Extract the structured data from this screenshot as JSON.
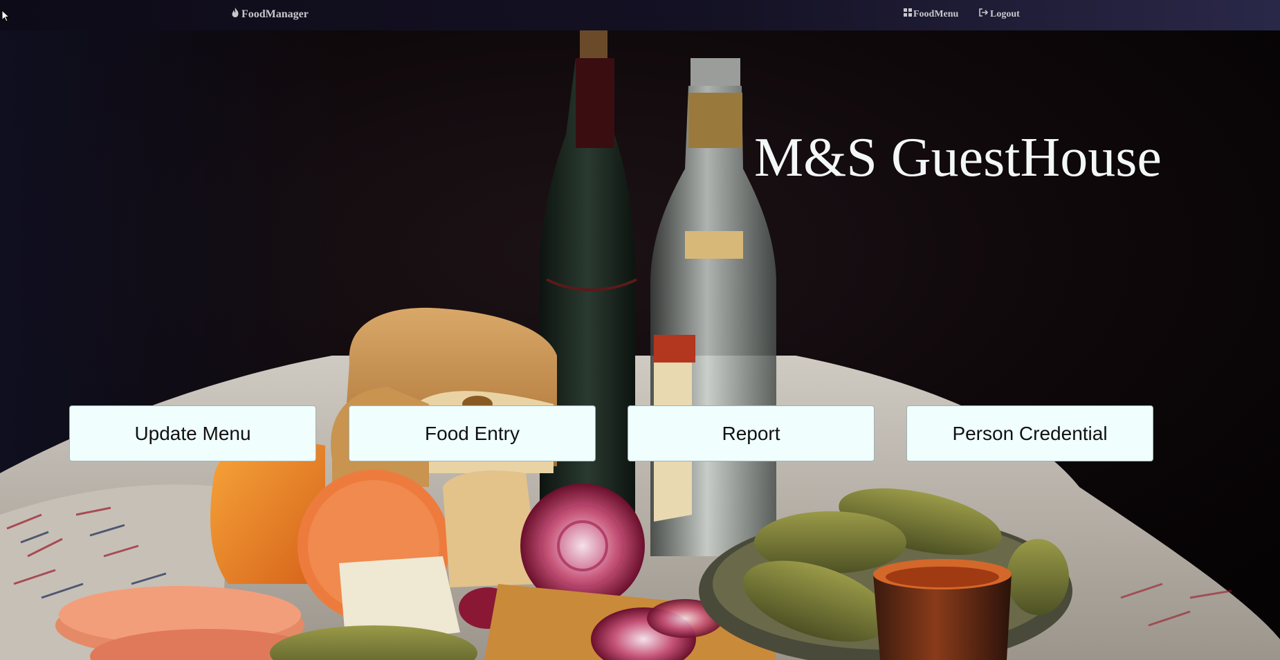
{
  "navbar": {
    "brand_label": "FoodManager",
    "brand_icon": "flame-icon",
    "links": [
      {
        "label": "FoodMenu",
        "icon": "grid-icon"
      },
      {
        "label": "Logout",
        "icon": "logout-icon"
      }
    ]
  },
  "hero": {
    "title": "M&S GuestHouse",
    "background": "still-life photo of bread, bottles, sausage, onions, pickles and a clay cup on a woven cloth"
  },
  "actions": [
    {
      "label": "Update Menu"
    },
    {
      "label": "Food Entry"
    },
    {
      "label": "Report"
    },
    {
      "label": "Person Credential"
    }
  ],
  "colors": {
    "navbar_bg": "#141124",
    "nav_text": "#c8c8cc",
    "title_text": "#f4f7f7",
    "button_bg": "#f0fefe",
    "button_text": "#111111"
  }
}
